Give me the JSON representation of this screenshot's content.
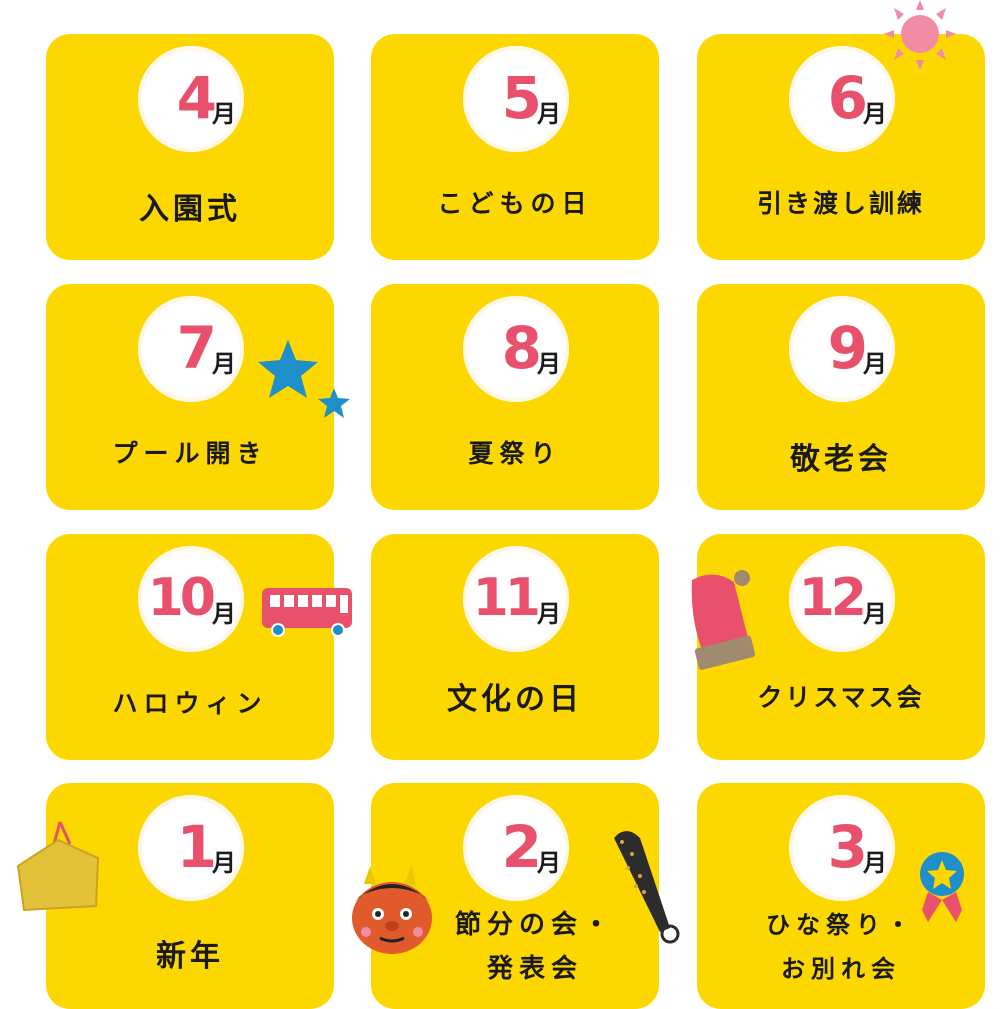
{
  "months": [
    {
      "num": "4",
      "unit": "月",
      "event": [
        "入園式"
      ]
    },
    {
      "num": "5",
      "unit": "月",
      "event": [
        "こどもの日"
      ]
    },
    {
      "num": "6",
      "unit": "月",
      "event": [
        "引き渡し訓練"
      ]
    },
    {
      "num": "7",
      "unit": "月",
      "event": [
        "プール開き"
      ]
    },
    {
      "num": "8",
      "unit": "月",
      "event": [
        "夏祭り"
      ]
    },
    {
      "num": "9",
      "unit": "月",
      "event": [
        "敬老会"
      ]
    },
    {
      "num": "10",
      "unit": "月",
      "event": [
        "ハロウィン"
      ]
    },
    {
      "num": "11",
      "unit": "月",
      "event": [
        "文化の日"
      ]
    },
    {
      "num": "12",
      "unit": "月",
      "event": [
        "クリスマス会"
      ]
    },
    {
      "num": "1",
      "unit": "月",
      "event": [
        "新年"
      ]
    },
    {
      "num": "2",
      "unit": "月",
      "event": [
        "節分の会・",
        "発表会"
      ]
    },
    {
      "num": "3",
      "unit": "月",
      "event": [
        "ひな祭り・",
        "お別れ会"
      ]
    }
  ],
  "colors": {
    "card": "#fdd800",
    "number": "#e8506b",
    "text": "#1a1a1a"
  },
  "icons": [
    "sun-icon",
    "star-icon",
    "bus-icon",
    "santa-hat-icon",
    "ema-plaque-icon",
    "oni-demon-icon",
    "oni-club-icon",
    "medal-icon"
  ]
}
